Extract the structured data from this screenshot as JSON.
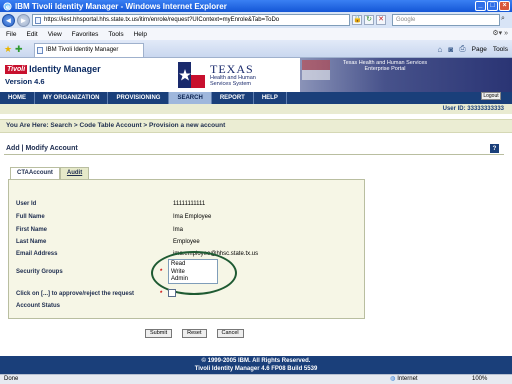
{
  "browser": {
    "window_title": "IBM Tivoli Identity Manager - Windows Internet Explorer",
    "url": "https://iest.hhsportal.hhs.state.tx.us/itim/enrole/request?UIContext=myEnrole&Tab=ToDo",
    "search_placeholder": "Google",
    "menu": [
      "File",
      "Edit",
      "View",
      "Favorites",
      "Tools",
      "Help"
    ],
    "tab_title": "IBM Tivoli Identity Manager",
    "page_menu": "Page",
    "tools_menu": "Tools"
  },
  "banner": {
    "tivoli_badge": "Tivoli",
    "product_name": "Identity Manager",
    "version": "Version 4.6",
    "texas": "TEXAS",
    "texas_sub": "Health and Human Services System",
    "portal": "Texas Health and Human Services Enterprise Portal",
    "logout": "Logout"
  },
  "nav": [
    "HOME",
    "MY ORGANIZATION",
    "PROVISIONING",
    "SEARCH",
    "REPORT",
    "HELP"
  ],
  "user_id_text": "User ID: 33333333333",
  "breadcrumb": "You Are Here: Search > Code Table Account > Provision a new account",
  "page_title": "Add | Modify Account",
  "help_icon": "?",
  "tabs": [
    "CTAAccount",
    "Audit"
  ],
  "form": {
    "user_id": {
      "label": "User Id",
      "value": "11111111111"
    },
    "full_name": {
      "label": "Full Name",
      "value": "Ima Employee"
    },
    "first_name": {
      "label": "First Name",
      "value": "Ima"
    },
    "last_name": {
      "label": "Last Name",
      "value": "Employee"
    },
    "email": {
      "label": "Email Address",
      "value": "ima.employee@hhsc.state.tx.us"
    },
    "security_groups": {
      "label": "Security Groups",
      "options": [
        "Read",
        "Write",
        "Admin"
      ]
    },
    "approve": {
      "label": "Click on [...] to approve/reject the request"
    },
    "account_status": {
      "label": "Account Status"
    },
    "required_marker": "*"
  },
  "buttons": {
    "submit": "Submit",
    "reset": "Reset",
    "cancel": "Cancel"
  },
  "footer": {
    "line1": "© 1999-2005 IBM. All Rights Reserved.",
    "line2": "Tivoli Identity Manager 4.6 FP08 Build 5539"
  },
  "status": {
    "left": "Done",
    "zone": "Internet",
    "zoom": "100%"
  }
}
